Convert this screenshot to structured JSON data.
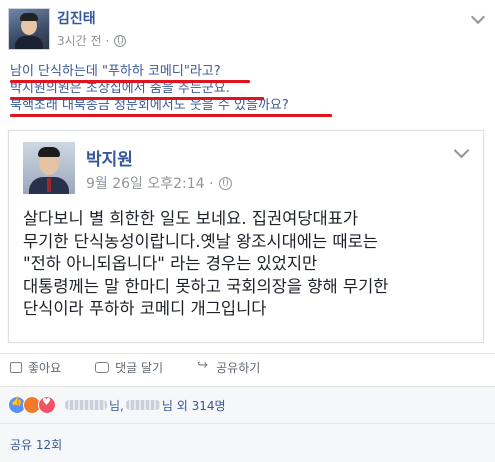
{
  "post": {
    "author": "김진태",
    "time": "3시간 전 ·",
    "lines": [
      "남이 단식하는데 \"푸하하 코메디\"라고?",
      "박지원의원은 초상집에서 춤을 추는군요.",
      "북핵초래 대북송금 청문회에서도 웃을 수 있을까요?"
    ]
  },
  "shared": {
    "author": "박지원",
    "time": "9월 26일 오후2:14 ·",
    "body": [
      "살다보니 별 희한한 일도 보네요. 집권여당대표가",
      "무기한 단식농성이랍니다.옛날 왕조시대에는 때로는",
      "\"전하  아니되옵니다\" 라는 경우는 있었지만",
      "대통령께는 말 한마디 못하고 국회의장을 향해 무기한",
      "단식이라 푸하하 코메디 개그입니다"
    ]
  },
  "actions": {
    "like": "좋아요",
    "comment": "댓글 달기",
    "share": "공유하기"
  },
  "reactions": {
    "name_suffix_1": "님,",
    "name_suffix_2": "님 외 314명",
    "icons": [
      "like-icon",
      "angry-icon",
      "love-icon"
    ]
  },
  "share_count": "공유 12회",
  "colors": {
    "link": "#365899",
    "underline": "#e0141e",
    "meta": "#90949c"
  }
}
